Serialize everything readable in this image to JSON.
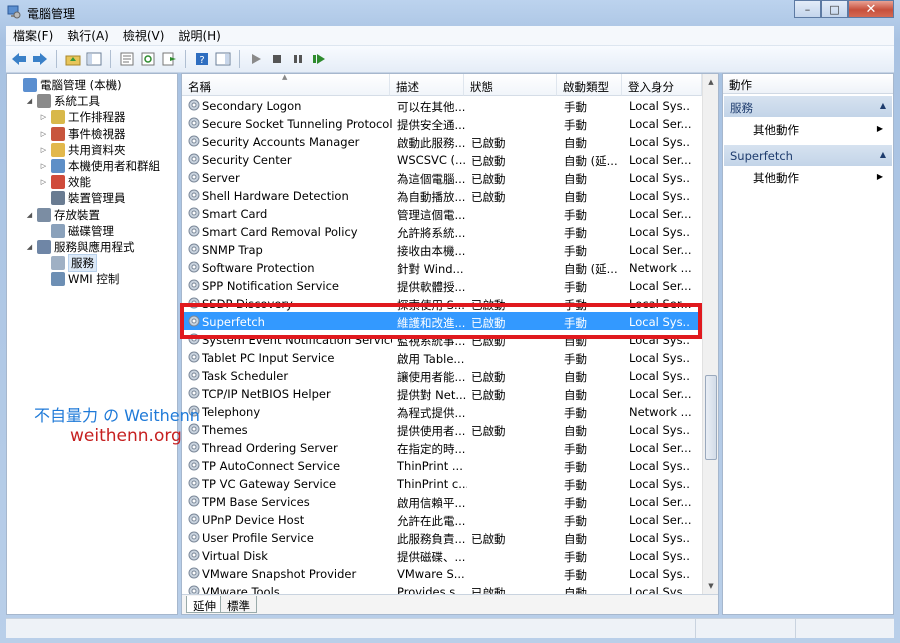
{
  "window": {
    "title": "電腦管理",
    "buttons": {
      "minimize": "–",
      "maximize": "□",
      "close": "✕"
    }
  },
  "menubar": [
    "檔案(F)",
    "執行(A)",
    "檢視(V)",
    "說明(H)"
  ],
  "tree": [
    {
      "label": "電腦管理 (本機)",
      "level": 0,
      "expander": "",
      "icon": "computer-management-icon"
    },
    {
      "label": "系統工具",
      "level": 1,
      "expander": "◢",
      "icon": "tools-icon"
    },
    {
      "label": "工作排程器",
      "level": 2,
      "expander": "▷",
      "icon": "clock-icon"
    },
    {
      "label": "事件檢視器",
      "level": 2,
      "expander": "▷",
      "icon": "event-viewer-icon"
    },
    {
      "label": "共用資料夾",
      "level": 2,
      "expander": "▷",
      "icon": "shared-folder-icon"
    },
    {
      "label": "本機使用者和群組",
      "level": 2,
      "expander": "▷",
      "icon": "users-icon"
    },
    {
      "label": "效能",
      "level": 2,
      "expander": "▷",
      "icon": "performance-icon"
    },
    {
      "label": "裝置管理員",
      "level": 2,
      "expander": "",
      "icon": "device-manager-icon"
    },
    {
      "label": "存放裝置",
      "level": 1,
      "expander": "◢",
      "icon": "storage-icon"
    },
    {
      "label": "磁碟管理",
      "level": 2,
      "expander": "",
      "icon": "disk-icon"
    },
    {
      "label": "服務與應用程式",
      "level": 1,
      "expander": "◢",
      "icon": "services-apps-icon"
    },
    {
      "label": "服務",
      "level": 2,
      "expander": "",
      "icon": "services-gear-icon",
      "selected": true
    },
    {
      "label": "WMI 控制",
      "level": 2,
      "expander": "",
      "icon": "wmi-icon"
    }
  ],
  "list": {
    "columns": [
      "名稱",
      "描述",
      "狀態",
      "啟動類型",
      "登入身分"
    ],
    "rows": [
      [
        "Secondary Logon",
        "可以在其他...",
        "",
        "手動",
        "Local Sys..."
      ],
      [
        "Secure Socket Tunneling Protocol S...",
        "提供安全通...",
        "",
        "手動",
        "Local Ser..."
      ],
      [
        "Security Accounts Manager",
        "啟動此服務...",
        "已啟動",
        "自動",
        "Local Sys..."
      ],
      [
        "Security Center",
        "WSCSVC (...",
        "已啟動",
        "自動 (延...",
        "Local Ser..."
      ],
      [
        "Server",
        "為這個電腦...",
        "已啟動",
        "自動",
        "Local Sys..."
      ],
      [
        "Shell Hardware Detection",
        "為自動播放...",
        "已啟動",
        "自動",
        "Local Sys..."
      ],
      [
        "Smart Card",
        "管理這個電...",
        "",
        "手動",
        "Local Ser..."
      ],
      [
        "Smart Card Removal Policy",
        "允許將系統...",
        "",
        "手動",
        "Local Sys..."
      ],
      [
        "SNMP Trap",
        "接收由本機...",
        "",
        "手動",
        "Local Ser..."
      ],
      [
        "Software Protection",
        "針對 Wind...",
        "",
        "自動 (延...",
        "Network ..."
      ],
      [
        "SPP Notification Service",
        "提供軟體授...",
        "",
        "手動",
        "Local Ser..."
      ],
      [
        "SSDP Discovery",
        "探索使用 S...",
        "已啟動",
        "手動",
        "Local Ser..."
      ],
      [
        "Superfetch",
        "維護和改進...",
        "已啟動",
        "手動",
        "Local Sys..."
      ],
      [
        "System Event Notification Service",
        "監視系統事...",
        "已啟動",
        "自動",
        "Local Sys..."
      ],
      [
        "Tablet PC Input Service",
        "啟用 Table...",
        "",
        "手動",
        "Local Sys..."
      ],
      [
        "Task Scheduler",
        "讓使用者能...",
        "已啟動",
        "自動",
        "Local Sys..."
      ],
      [
        "TCP/IP NetBIOS Helper",
        "提供對 Net...",
        "已啟動",
        "自動",
        "Local Ser..."
      ],
      [
        "Telephony",
        "為程式提供...",
        "",
        "手動",
        "Network ..."
      ],
      [
        "Themes",
        "提供使用者...",
        "已啟動",
        "自動",
        "Local Sys..."
      ],
      [
        "Thread Ordering Server",
        "在指定的時...",
        "",
        "手動",
        "Local Ser..."
      ],
      [
        "TP AutoConnect Service",
        "ThinPrint ...",
        "",
        "手動",
        "Local Sys..."
      ],
      [
        "TP VC Gateway Service",
        "ThinPrint c...",
        "",
        "手動",
        "Local Sys..."
      ],
      [
        "TPM Base Services",
        "啟用信賴平...",
        "",
        "手動",
        "Local Ser..."
      ],
      [
        "UPnP Device Host",
        "允許在此電...",
        "",
        "手動",
        "Local Ser..."
      ],
      [
        "User Profile Service",
        "此服務負責...",
        "已啟動",
        "自動",
        "Local Sys..."
      ],
      [
        "Virtual Disk",
        "提供磁碟、...",
        "",
        "手動",
        "Local Sys..."
      ],
      [
        "VMware Snapshot Provider",
        "VMware S...",
        "",
        "手動",
        "Local Sys..."
      ],
      [
        "VMware Tools",
        "Provides s...",
        "已啟動",
        "自動",
        "Local Sys..."
      ]
    ],
    "selected_row": "Superfetch",
    "tabs": [
      "延伸",
      "標準"
    ]
  },
  "actions": {
    "header": "動作",
    "sections": [
      {
        "title": "服務",
        "item": "其他動作"
      },
      {
        "title": "Superfetch",
        "item": "其他動作"
      }
    ]
  },
  "watermark": {
    "line1": "不自量力 の Weithenn",
    "line2": "weithenn.org"
  },
  "colors": {
    "selection": "#3399ff",
    "highlight_box": "#e0191e",
    "watermark_blue": "#1f7ad8",
    "watermark_red": "#c62020"
  }
}
